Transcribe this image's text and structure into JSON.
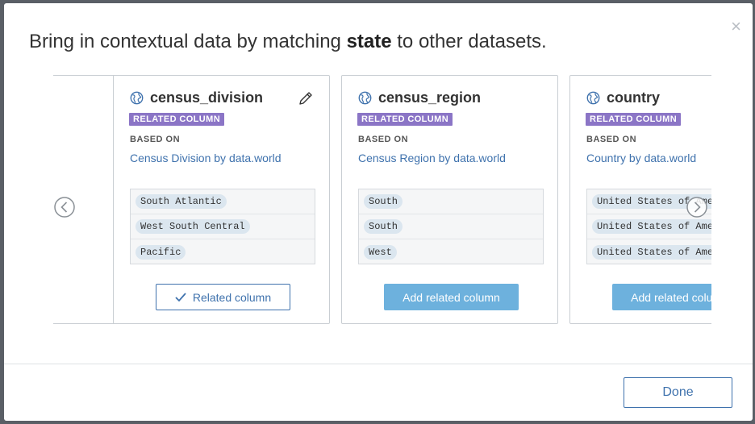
{
  "header": {
    "title_pre": "Bring in contextual data by matching ",
    "title_key": "state",
    "title_post": " to other datasets.",
    "close_glyph": "×"
  },
  "cards": [
    {
      "name": "census_division",
      "badge": "RELATED COLUMN",
      "based_on_label": "BASED ON",
      "source": "Census Division by data.world",
      "samples": [
        "South Atlantic",
        "West South Central",
        "Pacific"
      ],
      "button_label": "Related column",
      "button_state": "added"
    },
    {
      "name": "census_region",
      "badge": "RELATED COLUMN",
      "based_on_label": "BASED ON",
      "source": "Census Region by data.world",
      "samples": [
        "South",
        "South",
        "West"
      ],
      "button_label": "Add related column",
      "button_state": "available"
    },
    {
      "name": "country",
      "badge": "RELATED COLUMN",
      "based_on_label": "BASED ON",
      "source": "Country by data.world",
      "samples": [
        "United States of America",
        "United States of America",
        "United States of America"
      ],
      "button_label": "Add related column",
      "button_state": "available"
    }
  ],
  "partial_card": {
    "source_tail": "ld"
  },
  "footer": {
    "done_label": "Done"
  },
  "icons": {
    "card": "globe-icon",
    "edit": "pencil-icon",
    "prev": "chevron-left-circle-icon",
    "next": "chevron-right-circle-icon",
    "added": "checkmark-icon"
  },
  "colors": {
    "badge": "#8b75c6",
    "link": "#3f72ad",
    "primary_button": "#6db1dd",
    "chip": "#dbe6ef"
  }
}
